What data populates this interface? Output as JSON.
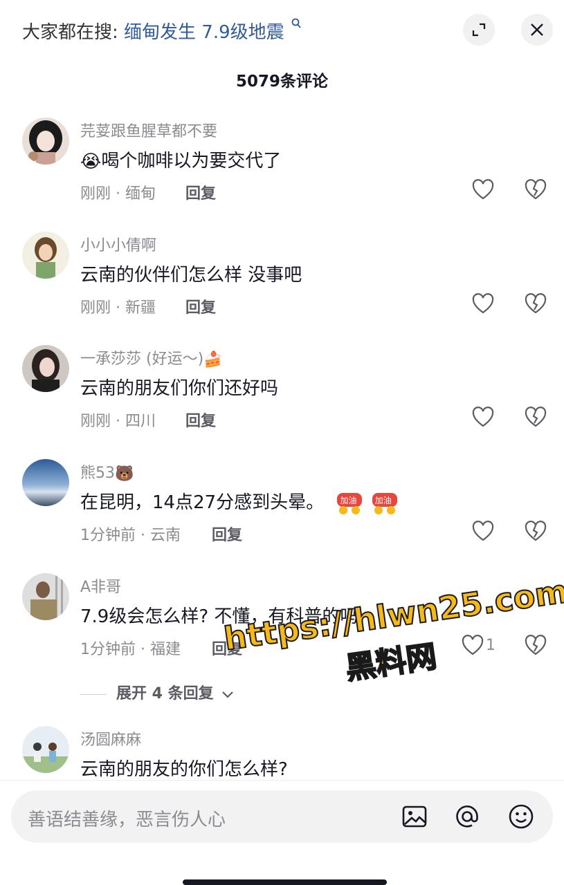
{
  "header": {
    "search_prefix": "大家都在搜:",
    "search_term": "缅甸发生 7.9级地震",
    "comment_count": "5079条评论"
  },
  "comments": [
    {
      "username": "芫荽跟鱼腥草都不要",
      "text": "喝个咖啡以为要交代了",
      "emoji_before": "😭",
      "meta": "刚刚 · 缅甸",
      "reply": "回复"
    },
    {
      "username": "小小小倩啊",
      "text": "云南的伙伴们怎么样  没事吧",
      "meta": "刚刚 · 新疆",
      "reply": "回复"
    },
    {
      "username": "一承莎莎 (好运～)",
      "username_emoji": "🍰",
      "text": "云南的朋友们你们还好吗",
      "meta": "刚刚 · 四川",
      "reply": "回复"
    },
    {
      "username": "熊53",
      "username_emoji": "🐻",
      "text": "在昆明，14点27分感到头晕。",
      "sticker1": "加油",
      "sticker2": "加油",
      "meta": "1分钟前 · 云南",
      "reply": "回复"
    },
    {
      "username": "A非哥",
      "text": "7.9级会怎么样? 不懂，有科普的吗",
      "meta": "1分钟前 · 福建",
      "reply": "回复",
      "likes": "1"
    },
    {
      "username": "汤圆麻麻",
      "text": "云南的朋友的你们怎么样?"
    }
  ],
  "expand_replies": "展开 4 条回复",
  "watermark": {
    "url": "https://hlwn25.com",
    "name": "黑料网"
  },
  "input": {
    "placeholder": "善语结善缘，恶言伤人心"
  },
  "icons": {
    "expand": "expand-icon",
    "close": "close-icon",
    "like": "heart-icon",
    "dislike": "broken-heart-icon",
    "image": "image-icon",
    "mention": "at-icon",
    "emoji": "smile-icon"
  }
}
